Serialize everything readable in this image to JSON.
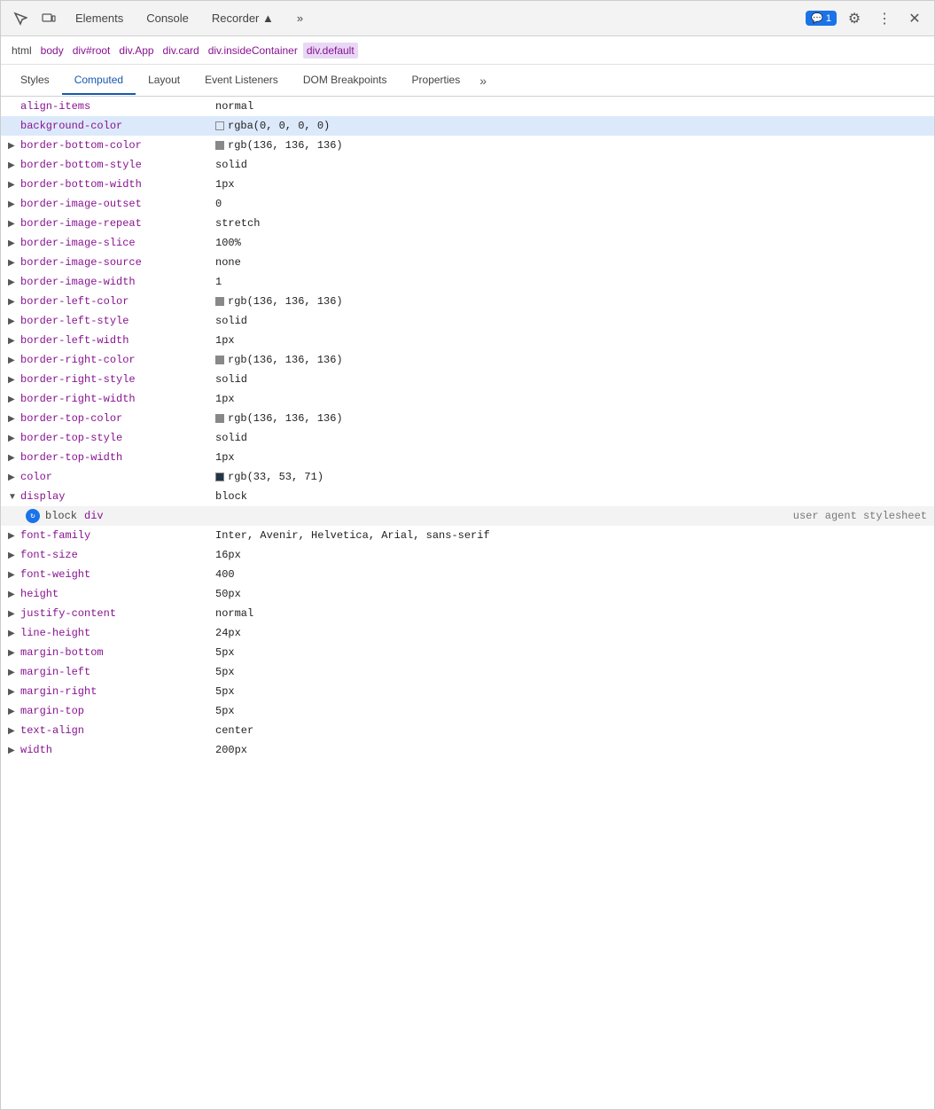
{
  "toolbar": {
    "inspect_icon": "⬚",
    "device_icon": "▭",
    "tabs": [
      {
        "label": "Elements",
        "active": true
      },
      {
        "label": "Console",
        "active": false
      },
      {
        "label": "Recorder ▲",
        "active": false
      }
    ],
    "more_tabs": "»",
    "badge_label": "💬 1",
    "settings_icon": "⚙",
    "more_icon": "⋮",
    "close_icon": "✕"
  },
  "breadcrumb": {
    "items": [
      {
        "label": "html",
        "style": "plain"
      },
      {
        "label": "body",
        "style": "purple"
      },
      {
        "label": "div#root",
        "style": "purple"
      },
      {
        "label": "div.App",
        "style": "purple"
      },
      {
        "label": "div.card",
        "style": "purple"
      },
      {
        "label": "div.insideContainer",
        "style": "purple"
      },
      {
        "label": "div.default",
        "style": "highlighted"
      }
    ]
  },
  "subtabs": {
    "items": [
      {
        "label": "Styles",
        "active": false
      },
      {
        "label": "Computed",
        "active": true
      },
      {
        "label": "Layout",
        "active": false
      },
      {
        "label": "Event Listeners",
        "active": false
      },
      {
        "label": "DOM Breakpoints",
        "active": false
      },
      {
        "label": "Properties",
        "active": false
      },
      {
        "label": "»",
        "active": false
      }
    ]
  },
  "properties": [
    {
      "has_arrow": false,
      "name": "align-items",
      "value": "normal",
      "color": null
    },
    {
      "has_arrow": false,
      "name": "background-color",
      "value": "rgba(0, 0, 0, 0)",
      "color": "rgba(0,0,0,0)",
      "highlighted": true
    },
    {
      "has_arrow": true,
      "name": "border-bottom-color",
      "value": "rgb(136, 136, 136)",
      "color": "rgb(136,136,136)"
    },
    {
      "has_arrow": true,
      "name": "border-bottom-style",
      "value": "solid",
      "color": null
    },
    {
      "has_arrow": true,
      "name": "border-bottom-width",
      "value": "1px",
      "color": null
    },
    {
      "has_arrow": true,
      "name": "border-image-outset",
      "value": "0",
      "color": null
    },
    {
      "has_arrow": true,
      "name": "border-image-repeat",
      "value": "stretch",
      "color": null
    },
    {
      "has_arrow": true,
      "name": "border-image-slice",
      "value": "100%",
      "color": null
    },
    {
      "has_arrow": true,
      "name": "border-image-source",
      "value": "none",
      "color": null
    },
    {
      "has_arrow": true,
      "name": "border-image-width",
      "value": "1",
      "color": null
    },
    {
      "has_arrow": true,
      "name": "border-left-color",
      "value": "rgb(136, 136, 136)",
      "color": "rgb(136,136,136)"
    },
    {
      "has_arrow": true,
      "name": "border-left-style",
      "value": "solid",
      "color": null
    },
    {
      "has_arrow": true,
      "name": "border-left-width",
      "value": "1px",
      "color": null
    },
    {
      "has_arrow": true,
      "name": "border-right-color",
      "value": "rgb(136, 136, 136)",
      "color": "rgb(136,136,136)"
    },
    {
      "has_arrow": true,
      "name": "border-right-style",
      "value": "solid",
      "color": null
    },
    {
      "has_arrow": true,
      "name": "border-right-width",
      "value": "1px",
      "color": null
    },
    {
      "has_arrow": true,
      "name": "border-top-color",
      "value": "rgb(136, 136, 136)",
      "color": "rgb(136,136,136)"
    },
    {
      "has_arrow": true,
      "name": "border-top-style",
      "value": "solid",
      "color": null
    },
    {
      "has_arrow": true,
      "name": "border-top-width",
      "value": "1px",
      "color": null
    },
    {
      "has_arrow": true,
      "name": "color",
      "value": "rgb(33, 53, 71)",
      "color": "rgb(33,53,71)"
    },
    {
      "has_arrow": false,
      "name": "display",
      "value": "block",
      "color": null,
      "expanded": true
    },
    {
      "has_arrow": true,
      "name": "font-family",
      "value": "Inter, Avenir, Helvetica, Arial, sans-serif",
      "color": null
    },
    {
      "has_arrow": true,
      "name": "font-size",
      "value": "16px",
      "color": null
    },
    {
      "has_arrow": true,
      "name": "font-weight",
      "value": "400",
      "color": null
    },
    {
      "has_arrow": true,
      "name": "height",
      "value": "50px",
      "color": null
    },
    {
      "has_arrow": true,
      "name": "justify-content",
      "value": "normal",
      "color": null
    },
    {
      "has_arrow": true,
      "name": "line-height",
      "value": "24px",
      "color": null
    },
    {
      "has_arrow": true,
      "name": "margin-bottom",
      "value": "5px",
      "color": null
    },
    {
      "has_arrow": true,
      "name": "margin-left",
      "value": "5px",
      "color": null
    },
    {
      "has_arrow": true,
      "name": "margin-right",
      "value": "5px",
      "color": null
    },
    {
      "has_arrow": true,
      "name": "margin-top",
      "value": "5px",
      "color": null
    },
    {
      "has_arrow": true,
      "name": "text-align",
      "value": "center",
      "color": null
    },
    {
      "has_arrow": true,
      "name": "width",
      "value": "200px",
      "color": null
    }
  ],
  "expanded_display": {
    "keyword": "block",
    "tag": "div",
    "source": "user agent stylesheet"
  },
  "colors": {
    "accent_blue": "#1a73e8",
    "breadcrumb_highlight_bg": "#e8d8f5",
    "property_highlight_bg": "#dce9fb",
    "prop_name_color": "#881391"
  }
}
